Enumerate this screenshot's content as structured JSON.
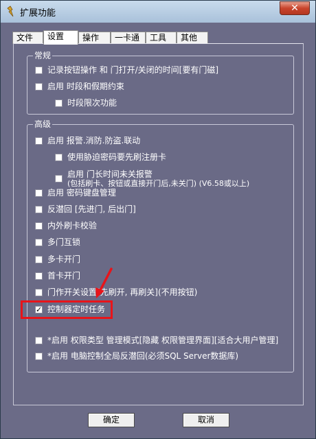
{
  "window": {
    "title": "扩展功能",
    "close_label": "✕"
  },
  "tabs": [
    "文件",
    "设置",
    "操作",
    "一卡通",
    "工具",
    "其他"
  ],
  "general": {
    "title": "常规",
    "items": [
      {
        "label": "记录按钮操作 和 门打开/关闭的时间[要有门磁]",
        "checked": false
      },
      {
        "label": "启用  时段和假期约束",
        "checked": false
      },
      {
        "label": "时段限次功能",
        "checked": false
      }
    ]
  },
  "advanced": {
    "title": "高级",
    "items": [
      {
        "label": "启用  报警.消防.防盗.联动",
        "checked": false
      },
      {
        "label": "使用胁迫密码要先刷注册卡",
        "checked": false
      },
      {
        "label": "启用  门长时间未关报警",
        "sub": "(包括刷卡、按钮或直接开门后,未关门)  (V6.58或以上)",
        "checked": false
      },
      {
        "label": "启用  密码键盘管理",
        "checked": false
      },
      {
        "label": "反潜回 [先进门, 后出门]",
        "checked": false
      },
      {
        "label": "内外刷卡校验",
        "checked": false
      },
      {
        "label": "多门互锁",
        "checked": false
      },
      {
        "label": "多卡开门",
        "checked": false
      },
      {
        "label": "首卡开门",
        "checked": false
      },
      {
        "label": "门作开关设置[先刷开, 再刷关](不用按钮)",
        "checked": false
      },
      {
        "label": "控制器定时任务",
        "checked": true
      },
      {
        "label": "*启用  权限类型 管理模式[隐藏 权限管理界面][适合大用户管理]",
        "checked": false
      },
      {
        "label": "*启用  电脑控制全局反潜回(必须SQL Server数据库)",
        "checked": false
      }
    ]
  },
  "buttons": {
    "ok": "确定",
    "cancel": "取消"
  },
  "colors": {
    "background": "#6a6a86",
    "highlight": "#e8141a",
    "title_bar": "#b8cde3"
  }
}
